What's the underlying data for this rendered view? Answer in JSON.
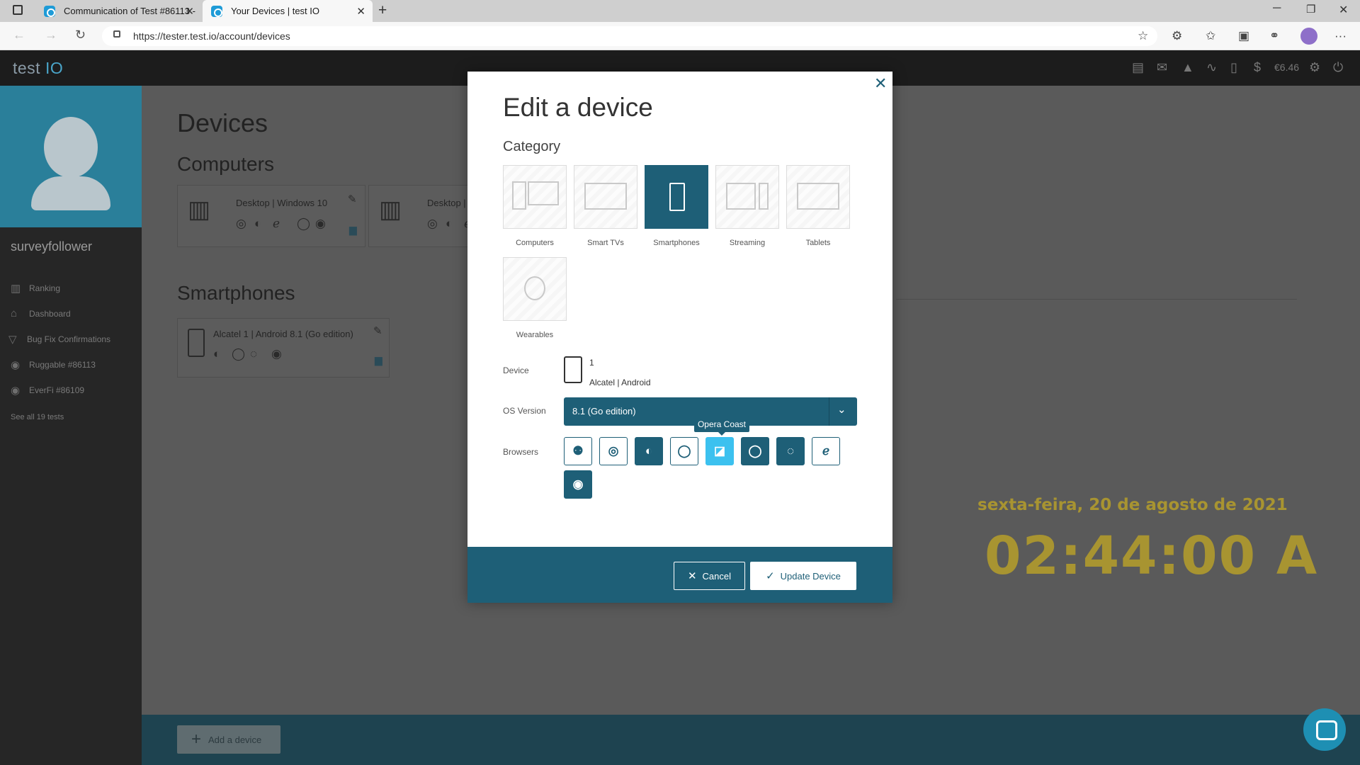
{
  "browser": {
    "tabs": [
      {
        "title": "Communication of Test #86113 -",
        "active": false
      },
      {
        "title": "Your Devices | test IO",
        "active": true
      }
    ],
    "url": "https://tester.test.io/account/devices"
  },
  "app": {
    "logo_main": "test ",
    "logo_accent": "IO",
    "balance": "€6.46"
  },
  "sidebar": {
    "username": "surveyfollower",
    "items": [
      {
        "label": "Ranking",
        "icon": "ranking-icon"
      },
      {
        "label": "Dashboard",
        "icon": "home-icon"
      },
      {
        "label": "Bug Fix Confirmations",
        "icon": "filter-icon"
      },
      {
        "label": "Ruggable #86113",
        "icon": "play-icon"
      },
      {
        "label": "EverFi #86109",
        "icon": "play-icon"
      }
    ],
    "see_all": "See all 19 tests"
  },
  "page": {
    "title": "Devices",
    "section_computers": "Computers",
    "computers": [
      {
        "name": "Desktop | Windows 10"
      },
      {
        "name": "Desktop | W"
      }
    ],
    "section_smartphones": "Smartphones",
    "smartphones": [
      {
        "name": "Alcatel 1 | Android 8.1 (Go edition)"
      }
    ],
    "add_device": "Add a device"
  },
  "clock": {
    "date": "sexta-feira, 20 de agosto de 2021",
    "time": "02:44:00 A"
  },
  "modal": {
    "title": "Edit a device",
    "category_label": "Category",
    "categories": [
      {
        "label": "Computers",
        "selected": false
      },
      {
        "label": "Smart TVs",
        "selected": false
      },
      {
        "label": "Smartphones",
        "selected": true
      },
      {
        "label": "Streaming",
        "selected": false
      },
      {
        "label": "Tablets",
        "selected": false
      },
      {
        "label": "Wearables",
        "selected": false
      }
    ],
    "device_label": "Device",
    "device_number": "1",
    "device_sub": "Alcatel | Android",
    "os_label": "OS Version",
    "os_value": "8.1 (Go edition)",
    "browsers_label": "Browsers",
    "tooltip": "Opera Coast",
    "cancel": "Cancel",
    "update": "Update Device"
  },
  "colors": {
    "accent": "#1e5f77",
    "highlight": "#3cc1ef",
    "clock": "#a89431"
  }
}
